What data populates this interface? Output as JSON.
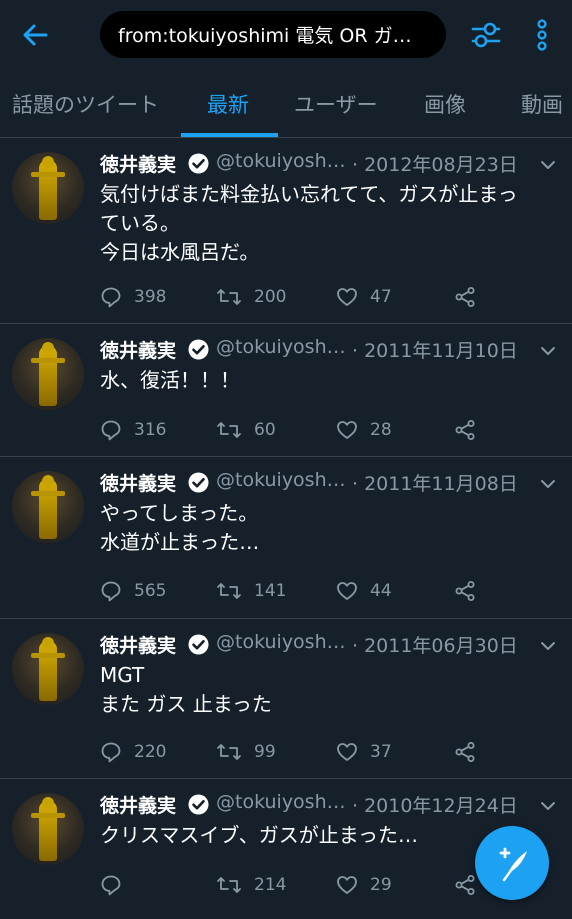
{
  "search": {
    "query": "from:tokuiyoshimi 電気 OR ガ…"
  },
  "tabs": [
    {
      "label": "話題のツイート",
      "active": false
    },
    {
      "label": "最新",
      "active": true
    },
    {
      "label": "ユーザー",
      "active": false
    },
    {
      "label": "画像",
      "active": false
    },
    {
      "label": "動画",
      "active": false
    }
  ],
  "colors": {
    "background": "#15202b",
    "accent": "#1da1f2",
    "muted": "#8899a6",
    "divider": "#38444d"
  },
  "icons": [
    "back-arrow-icon",
    "filter-sliders-icon",
    "more-vertical-icon",
    "verified-badge-icon",
    "chevron-down-icon",
    "reply-icon",
    "retweet-icon",
    "like-icon",
    "share-icon",
    "compose-tweet-icon"
  ],
  "tweets": [
    {
      "name": "徳井義実",
      "handle": "@tokuiyosh…",
      "date": "· 2012年08月23日",
      "lines": [
        "気付けばまた料金払い忘れてて、ガスが止まっ",
        "ている。",
        "今日は水風呂だ。"
      ],
      "replies": "398",
      "retweets": "200",
      "likes": "47"
    },
    {
      "name": "徳井義実",
      "handle": "@tokuiyosh…",
      "date": "· 2011年11月10日",
      "lines": [
        "水、復活！！！"
      ],
      "replies": "316",
      "retweets": "60",
      "likes": "28"
    },
    {
      "name": "徳井義実",
      "handle": "@tokuiyosh…",
      "date": "· 2011年11月08日",
      "lines": [
        "やってしまった。",
        "水道が止まった…"
      ],
      "replies": "565",
      "retweets": "141",
      "likes": "44"
    },
    {
      "name": "徳井義実",
      "handle": "@tokuiyosh…",
      "date": "· 2011年06月30日",
      "lines": [
        "MGT",
        "また ガス 止まった"
      ],
      "replies": "220",
      "retweets": "99",
      "likes": "37"
    },
    {
      "name": "徳井義実",
      "handle": "@tokuiyosh…",
      "date": "· 2010年12月24日",
      "lines": [
        "クリスマスイブ、ガスが止まった…"
      ],
      "replies": "",
      "retweets": "214",
      "likes": "29"
    }
  ]
}
